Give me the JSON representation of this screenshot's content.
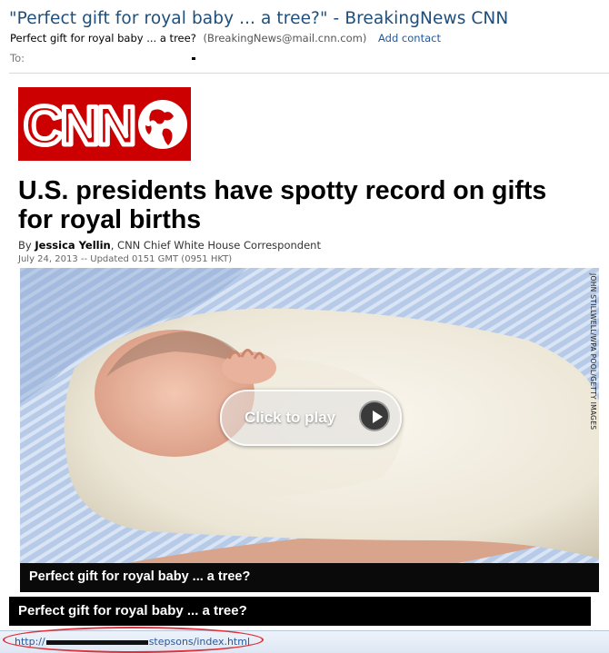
{
  "email": {
    "subject": "\"Perfect gift for royal baby ... a tree?\" -  BreakingNews CNN",
    "from_name": "Perfect gift for royal baby ... a tree?",
    "from_address": "(BreakingNews@mail.cnn.com)",
    "add_contact": "Add contact",
    "to_label": "To:"
  },
  "article": {
    "logo_text": "CNN",
    "headline": "U.S. presidents have spotty record on gifts for royal births",
    "by_prefix": "By ",
    "author": "Jessica Yellin",
    "author_title": ", CNN Chief White House Correspondent",
    "date": "July 24, 2013 -- Updated 0151 GMT (0951 HKT)",
    "photo_credit": "JOHN STILLWELL/WPA POOL/GETTY IMAGES",
    "play_label": "Click to play",
    "photo_caption": "Perfect gift for royal baby ... a tree?",
    "link_text": "Perfect gift for royal baby ... a tree?"
  },
  "status_bar": {
    "url_prefix": "http://",
    "url_suffix": "stepsons/index.html"
  },
  "colors": {
    "cnn_red": "#cc0000",
    "subject_blue": "#1e4e79",
    "link_blue": "#1e5a9c",
    "highlight_red": "#e0303a"
  },
  "icons": {
    "play": "play-icon",
    "globe": "globe-icon"
  }
}
